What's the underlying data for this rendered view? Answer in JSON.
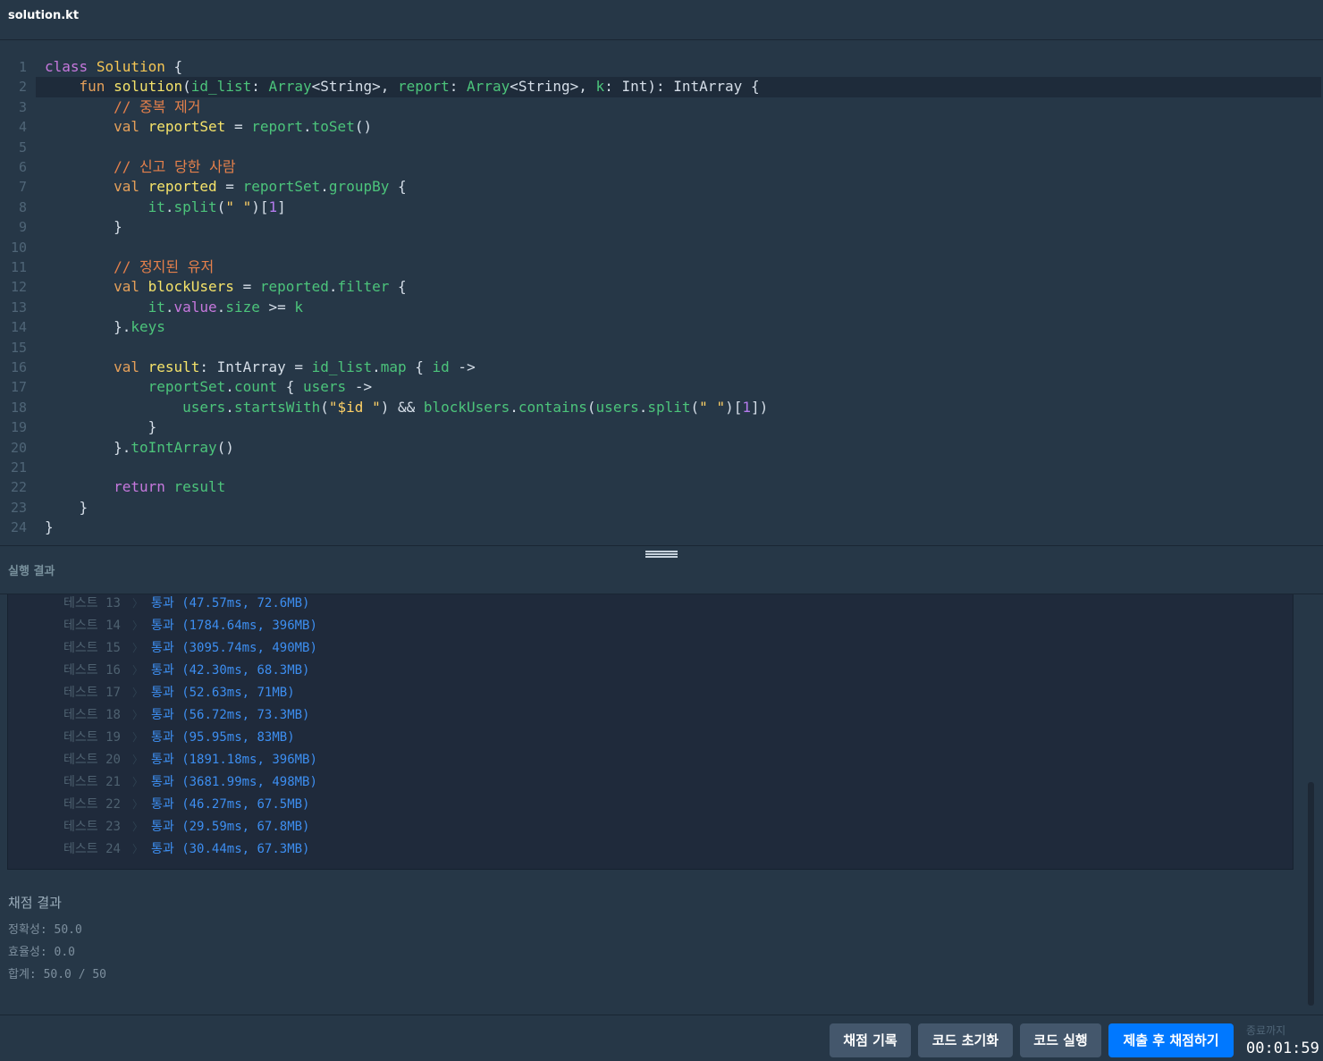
{
  "file_tab": {
    "name": "solution.kt"
  },
  "panel": {
    "title": "실행 결과"
  },
  "tests": [
    {
      "label": "테스트 13",
      "result": "통과 (47.57ms, 72.6MB)"
    },
    {
      "label": "테스트 14",
      "result": "통과 (1784.64ms, 396MB)"
    },
    {
      "label": "테스트 15",
      "result": "통과 (3095.74ms, 490MB)"
    },
    {
      "label": "테스트 16",
      "result": "통과 (42.30ms, 68.3MB)"
    },
    {
      "label": "테스트 17",
      "result": "통과 (52.63ms, 71MB)"
    },
    {
      "label": "테스트 18",
      "result": "통과 (56.72ms, 73.3MB)"
    },
    {
      "label": "테스트 19",
      "result": "통과 (95.95ms, 83MB)"
    },
    {
      "label": "테스트 20",
      "result": "통과 (1891.18ms, 396MB)"
    },
    {
      "label": "테스트 21",
      "result": "통과 (3681.99ms, 498MB)"
    },
    {
      "label": "테스트 22",
      "result": "통과 (46.27ms, 67.5MB)"
    },
    {
      "label": "테스트 23",
      "result": "통과 (29.59ms, 67.8MB)"
    },
    {
      "label": "테스트 24",
      "result": "통과 (30.44ms, 67.3MB)"
    }
  ],
  "test_separator": "〉",
  "score": {
    "title": "채점 결과",
    "accuracy": "정확성: 50.0",
    "efficiency": "효율성: 0.0",
    "total": "합계: 50.0 / 50"
  },
  "footer": {
    "history_label": "채점 기록",
    "reset_label": "코드 초기화",
    "run_label": "코드 실행",
    "submit_label": "제출 후 채점하기",
    "timer_label": "종료까지",
    "timer_value": "00:01:59"
  },
  "colors": {
    "submit": "#0078ff",
    "background": "#263747",
    "pass": "#3d8ef0"
  }
}
